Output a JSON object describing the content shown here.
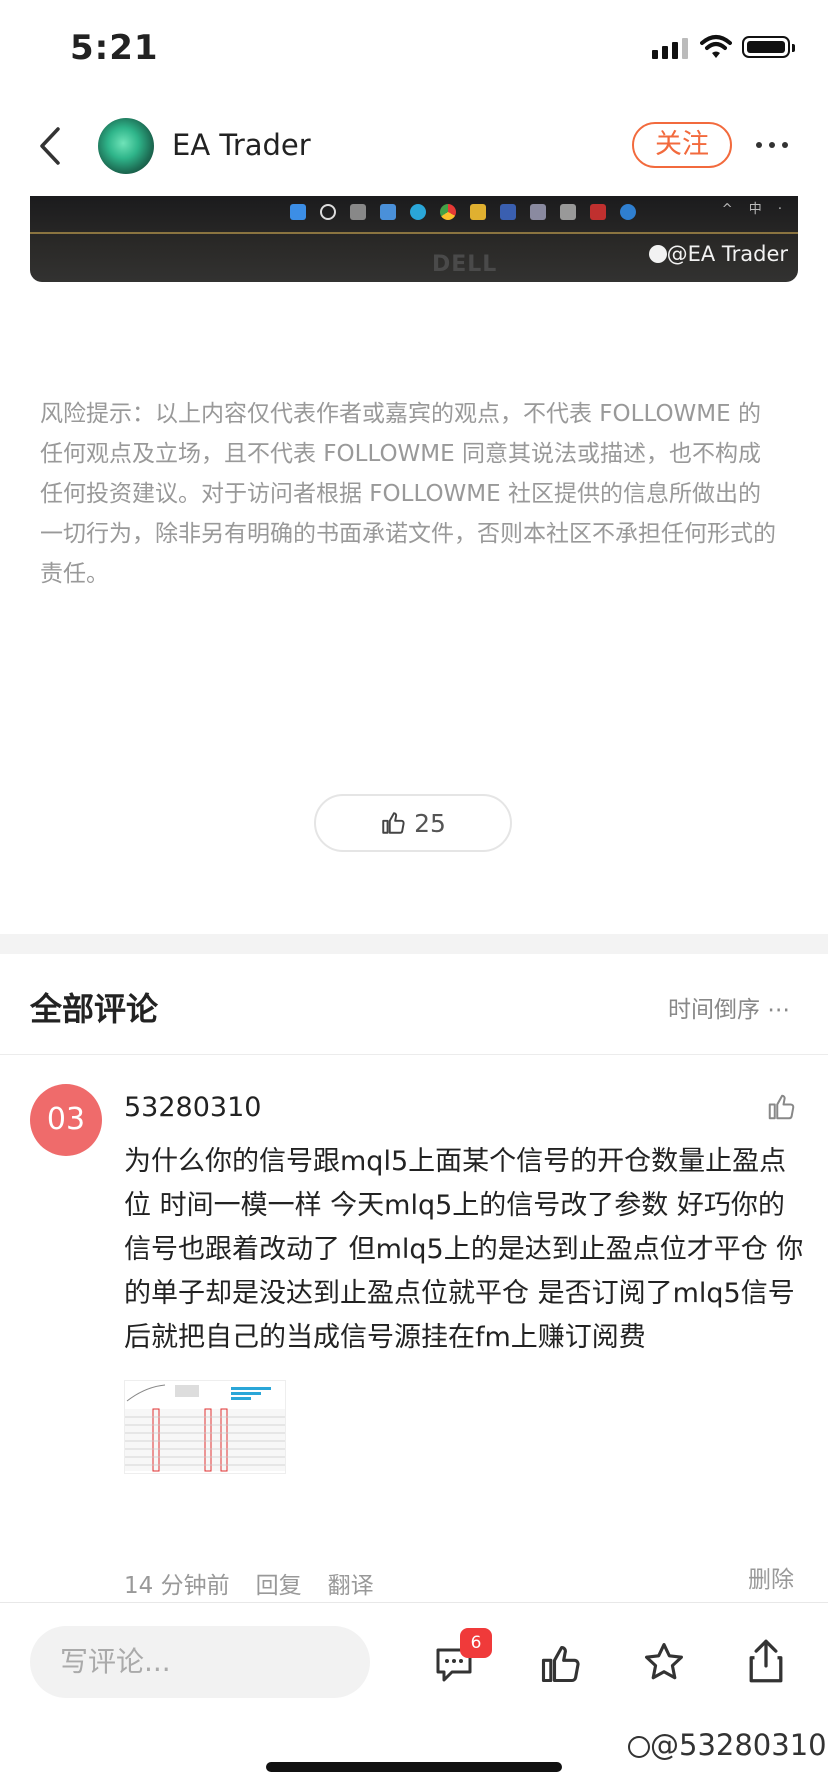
{
  "status_bar": {
    "time": "5:21"
  },
  "header": {
    "author": "EA Trader",
    "follow_label": "关注"
  },
  "image": {
    "watermark": "@EA Trader",
    "brand": "DELL",
    "tray_text": "^ 中 ·"
  },
  "disclaimer": "风险提示：以上内容仅代表作者或嘉宾的观点，不代表 FOLLOWME 的任何观点及立场，且不代表 FOLLOWME 同意其说法或描述，也不构成任何投资建议。对于访问者根据 FOLLOWME 社区提供的信息所做出的一切行为，除非另有明确的书面承诺文件，否则本社区不承担任何形式的责任。",
  "like_count": "25",
  "comments": {
    "title": "全部评论",
    "sort_label": "时间倒序 ⋯",
    "item": {
      "avatar_text": "03",
      "username": "53280310",
      "text": "为什么你的信号跟mql5上面某个信号的开仓数量止盈点位 时间一模一样 今天mlq5上的信号改了参数 好巧你的信号也跟着改动了 但mlq5上的是达到止盈点位才平仓 你的单子却是没达到止盈点位就平仓 是否订阅了mlq5信号后就把自己的当成信号源挂在fm上赚订阅费",
      "time": "14 分钟前",
      "reply": "回复",
      "translate": "翻译",
      "delete": "删除"
    }
  },
  "bottom_bar": {
    "input_placeholder": "写评论...",
    "comment_badge": "6"
  },
  "bottom_watermark": "@53280310"
}
